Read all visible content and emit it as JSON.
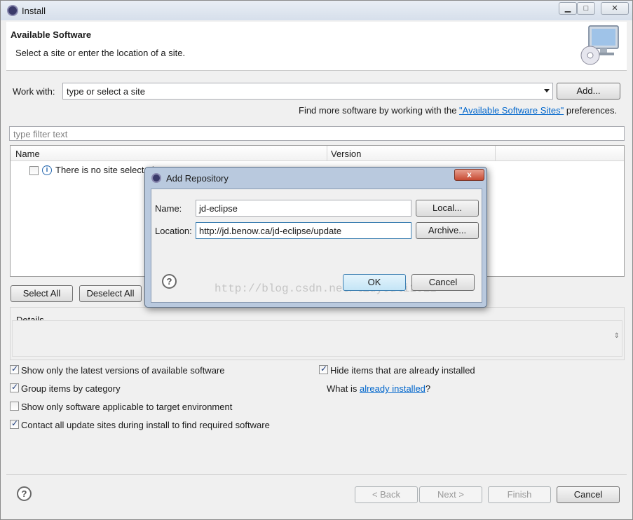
{
  "window": {
    "title": "Install",
    "minimize": "▁",
    "maximize": "□",
    "close": "✕"
  },
  "banner": {
    "title": "Available Software",
    "subtitle": "Select a site or enter the location of a site."
  },
  "work_with": {
    "label": "Work with:",
    "value": "type or select a site",
    "add_button": "Add...",
    "hint_prefix": "Find more software by working with the ",
    "hint_link": "\"Available Software Sites\"",
    "hint_suffix": " preferences."
  },
  "filter": {
    "placeholder": "type filter text"
  },
  "table": {
    "columns": [
      "Name",
      "Version"
    ],
    "rows": [
      {
        "checked": false,
        "text": "There is no site selected."
      }
    ]
  },
  "selection_buttons": {
    "select_all": "Select All",
    "deselect_all": "Deselect All"
  },
  "details": {
    "label": "Details"
  },
  "options": {
    "show_latest": {
      "label": "Show only the latest versions of available software",
      "checked": true
    },
    "group_by_category": {
      "label": "Group items by category",
      "checked": true
    },
    "applicable_only": {
      "label": "Show only software applicable to target environment",
      "checked": false
    },
    "contact_sites": {
      "label": "Contact all update sites during install to find required software",
      "checked": true
    },
    "hide_installed": {
      "label": "Hide items that are already installed",
      "checked": true
    },
    "what_is_prefix": "What is ",
    "what_is_link": "already installed",
    "what_is_suffix": "?"
  },
  "footer": {
    "back": "< Back",
    "next": "Next >",
    "finish": "Finish",
    "cancel": "Cancel"
  },
  "dialog": {
    "title": "Add Repository",
    "close": "x",
    "name_label": "Name:",
    "name_value": "jd-eclipse",
    "local_button": "Local...",
    "location_label": "Location:",
    "location_value": "http://jd.benow.ca/jd-eclipse/update",
    "archive_button": "Archive...",
    "ok_button": "OK",
    "cancel_button": "Cancel"
  },
  "watermark": "http://blog.csdn.net/liuyouli2012",
  "help_symbol": "?",
  "info_symbol": "i",
  "colors": {
    "link": "#0066cc",
    "dialog_frame": "#b9c9de",
    "close_button": "#c74a32"
  }
}
